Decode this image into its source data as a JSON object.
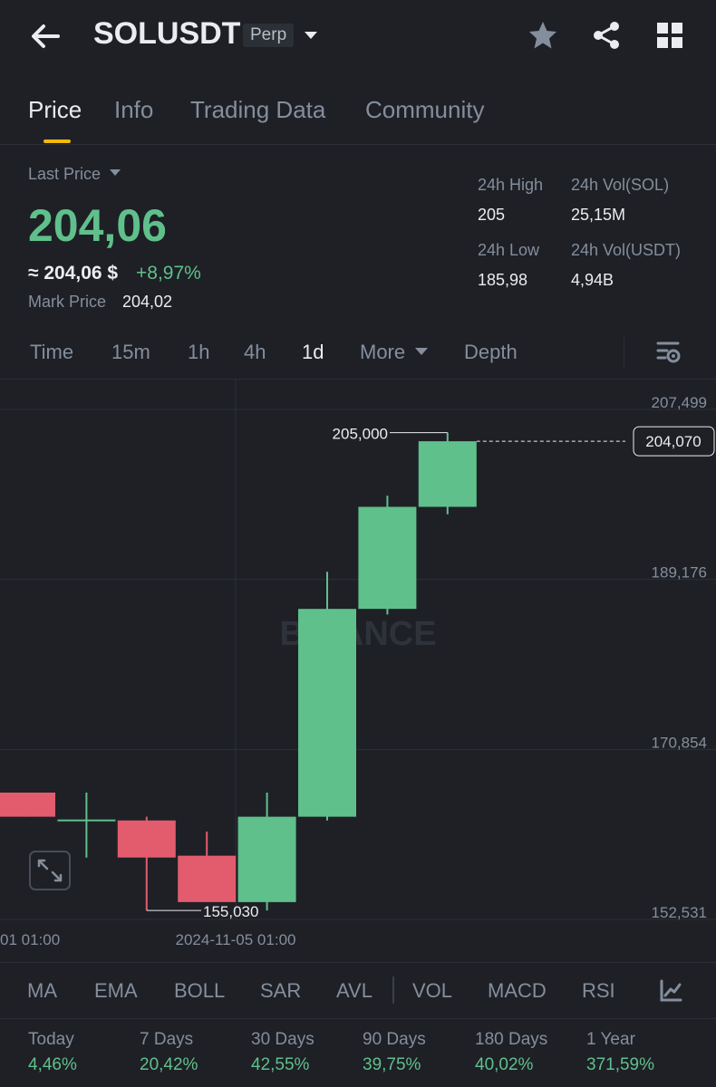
{
  "header": {
    "symbol": "SOLUSDT",
    "contract_type": "Perp",
    "icons": [
      "back-arrow-icon",
      "chevron-down-icon",
      "star-icon",
      "share-icon",
      "grid-icon"
    ]
  },
  "tabs": [
    {
      "label": "Price",
      "active": true
    },
    {
      "label": "Info",
      "active": false
    },
    {
      "label": "Trading Data",
      "active": false
    },
    {
      "label": "Community",
      "active": false
    }
  ],
  "price": {
    "last_price_label": "Last Price",
    "last_price": "204,06",
    "approx": "≈ 204,06 $",
    "change": "+8,97%",
    "mark_label": "Mark Price",
    "mark_price": "204,02"
  },
  "stats": {
    "high_label": "24h High",
    "high": "205",
    "low_label": "24h Low",
    "low": "185,98",
    "vol_sol_label": "24h Vol(SOL)",
    "vol_sol": "25,15M",
    "vol_usdt_label": "24h Vol(USDT)",
    "vol_usdt": "4,94B"
  },
  "intervals": [
    {
      "label": "Time",
      "active": false
    },
    {
      "label": "15m",
      "active": false
    },
    {
      "label": "1h",
      "active": false
    },
    {
      "label": "4h",
      "active": false
    },
    {
      "label": "1d",
      "active": true
    },
    {
      "label": "More",
      "active": false
    },
    {
      "label": "Depth",
      "active": false
    }
  ],
  "colors": {
    "up": "#5fc08b",
    "down": "#e25c6d",
    "accent": "#f0b90b",
    "bg": "#1e2026"
  },
  "chart_data": {
    "type": "candlestick",
    "y_ticks": [
      "207,499",
      "189,176",
      "170,854",
      "152,531"
    ],
    "x_ticks": [
      "01 01:00",
      "2024-11-05 01:00"
    ],
    "current_price_label": "204,070",
    "max_label": "205,000",
    "min_label": "155,030",
    "watermark": "BINANCE",
    "candles": [
      {
        "open": 166.2,
        "high": 166.2,
        "low": 163.6,
        "close": 163.6
      },
      {
        "open": 163.3,
        "high": 166.2,
        "low": 159.2,
        "close": 163.3
      },
      {
        "open": 163.2,
        "high": 163.6,
        "low": 153.5,
        "close": 159.2
      },
      {
        "open": 159.4,
        "high": 162.0,
        "low": 155.03,
        "close": 154.4
      },
      {
        "open": 154.4,
        "high": 166.2,
        "low": 153.5,
        "close": 163.6
      },
      {
        "open": 163.6,
        "high": 190.0,
        "low": 163.2,
        "close": 186.0
      },
      {
        "open": 186.0,
        "high": 198.2,
        "low": 185.4,
        "close": 197.0
      },
      {
        "open": 197.0,
        "high": 205.0,
        "low": 196.2,
        "close": 204.07
      }
    ]
  },
  "indicators": [
    "MA",
    "EMA",
    "BOLL",
    "SAR",
    "AVL",
    "VOL",
    "MACD",
    "RSI"
  ],
  "performance": [
    {
      "label": "Today",
      "value": "4,46%"
    },
    {
      "label": "7 Days",
      "value": "20,42%"
    },
    {
      "label": "30 Days",
      "value": "42,55%"
    },
    {
      "label": "90 Days",
      "value": "39,75%"
    },
    {
      "label": "180 Days",
      "value": "40,02%"
    },
    {
      "label": "1 Year",
      "value": "371,59%"
    }
  ]
}
